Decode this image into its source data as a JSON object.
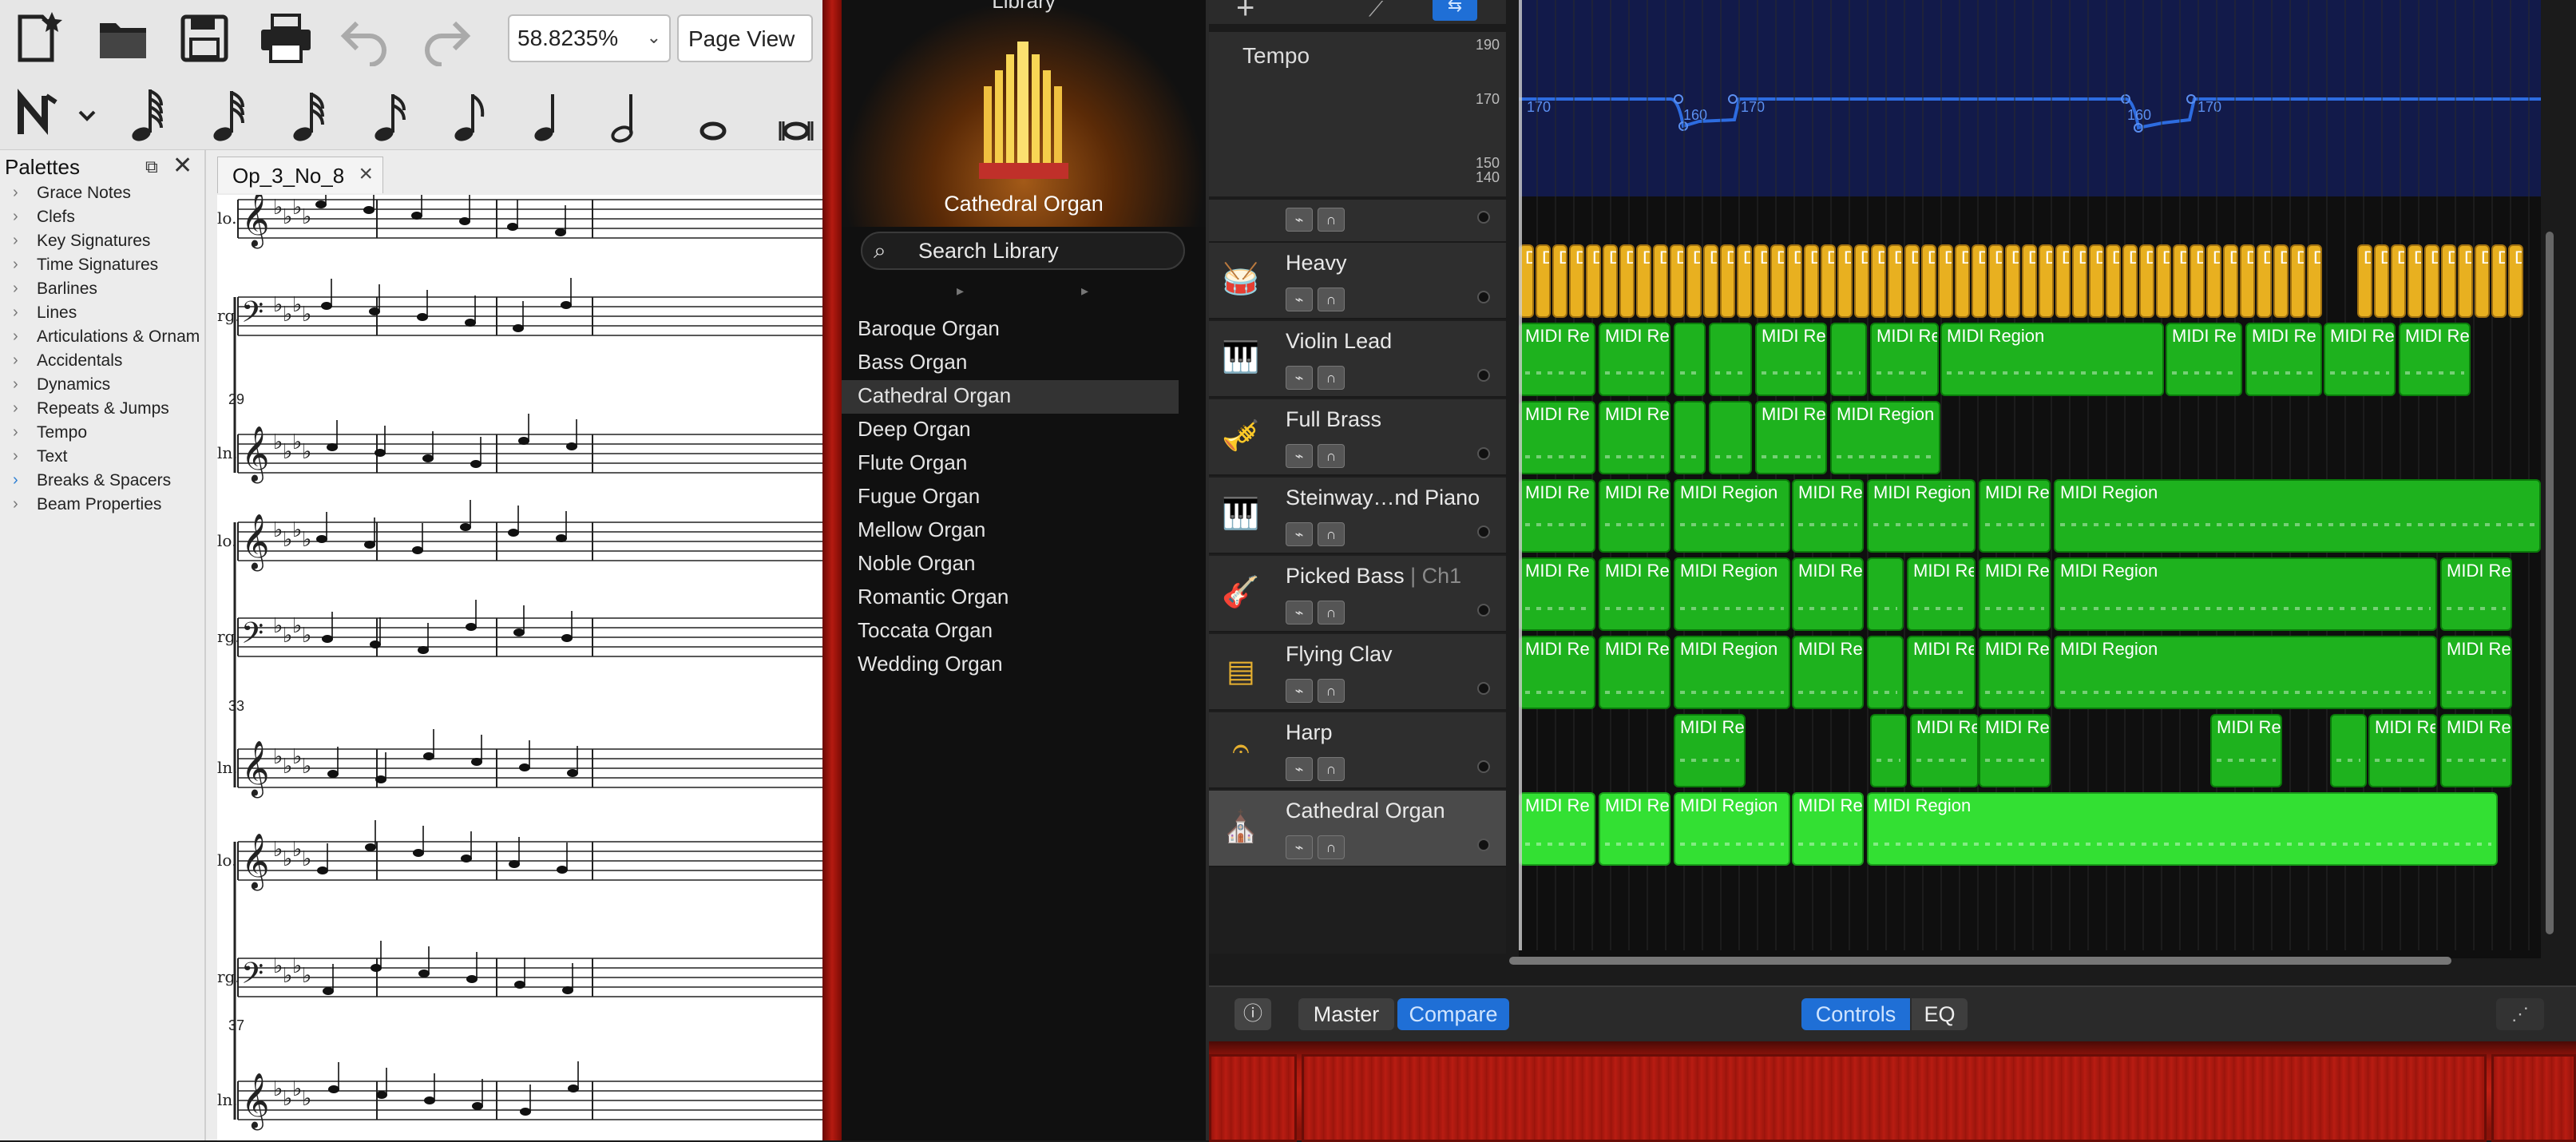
{
  "musescore": {
    "zoom_value": "58.8235%",
    "page_view_label": "Page View",
    "palettes_title": "Palettes",
    "palettes": [
      "Grace Notes",
      "Clefs",
      "Key Signatures",
      "Time Signatures",
      "Barlines",
      "Lines",
      "Articulations & Ornam",
      "Accidentals",
      "Dynamics",
      "Repeats & Jumps",
      "Tempo",
      "Text",
      "Breaks & Spacers",
      "Beam Properties"
    ],
    "score_tab": "Op_3_No_8",
    "measure_numbers": [
      "29",
      "33",
      "37"
    ],
    "staff_labels": [
      "lo.",
      "rg.",
      "ln.",
      "lo.",
      "rg.",
      "ln.",
      "lo.",
      "rg.",
      "ln."
    ]
  },
  "library": {
    "title": "Library",
    "selected_instrument": "Cathedral Organ",
    "search_placeholder": "Search Library",
    "items": [
      "Baroque Organ",
      "Bass Organ",
      "Cathedral Organ",
      "Deep Organ",
      "Flute Organ",
      "Fugue Organ",
      "Mellow Organ",
      "Noble Organ",
      "Romantic Organ",
      "Toccata Organ",
      "Wedding Organ"
    ]
  },
  "garageband": {
    "tempo_label": "Tempo",
    "tempo_scale": [
      "190",
      "170",
      "150",
      "140"
    ],
    "tempo_points": [
      "170",
      "160",
      "170",
      "160",
      "170"
    ],
    "tracks": [
      {
        "name": "Heavy",
        "suffix": "",
        "icon": "drum-kit-icon"
      },
      {
        "name": "Violin Lead",
        "suffix": "",
        "icon": "keyboard-icon"
      },
      {
        "name": "Full Brass",
        "suffix": "",
        "icon": "brass-icon"
      },
      {
        "name": "Steinway…nd Piano",
        "suffix": "",
        "icon": "grand-piano-icon"
      },
      {
        "name": "Picked Bass",
        "suffix": " | Ch1",
        "icon": "bass-guitar-icon"
      },
      {
        "name": "Flying Clav",
        "suffix": "",
        "icon": "clavinet-icon"
      },
      {
        "name": "Harp",
        "suffix": "",
        "icon": "harp-icon"
      },
      {
        "name": "Cathedral Organ",
        "suffix": "",
        "icon": "organ-icon"
      }
    ],
    "region_label_full": "MIDI Region",
    "region_label_short": "MIDI Re",
    "drum_label": "Dr",
    "bottom": {
      "master": "Master",
      "compare": "Compare",
      "controls": "Controls",
      "eq": "EQ"
    }
  }
}
